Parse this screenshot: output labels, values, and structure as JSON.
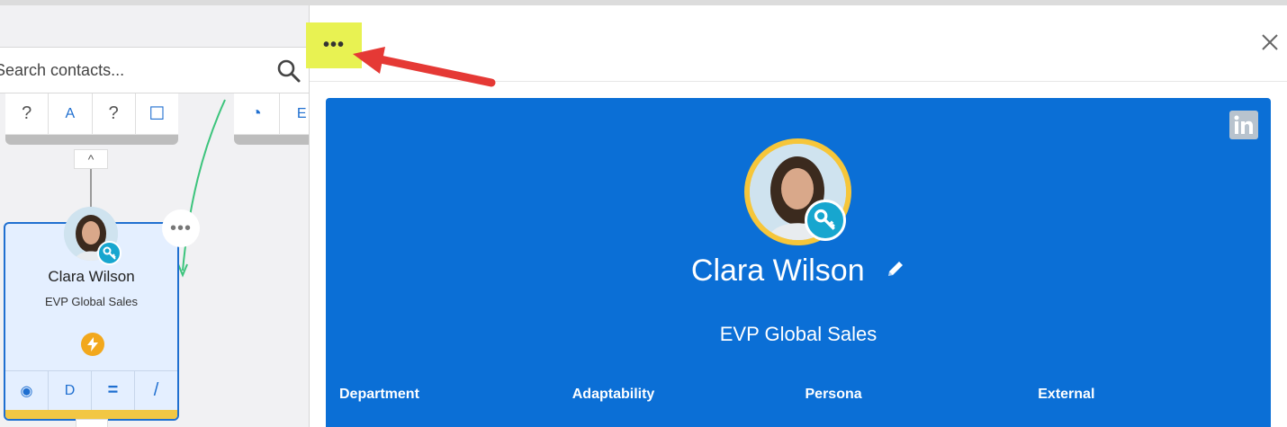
{
  "search": {
    "placeholder": "Search contacts..."
  },
  "top_card_left": {
    "cells": [
      "?",
      "A",
      "?",
      "☐"
    ]
  },
  "top_card_right": {
    "cells": [
      "◔",
      "E"
    ]
  },
  "collapse_label": "^",
  "contact_card": {
    "name": "Clara Wilson",
    "title": "EVP Global Sales",
    "actions": [
      "◉",
      "D",
      "=",
      "/"
    ]
  },
  "panel": {
    "more_label": "•••",
    "profile": {
      "name": "Clara Wilson",
      "title": "EVP Global Sales",
      "fields": [
        "Department",
        "Adaptability",
        "Persona",
        "External"
      ]
    }
  },
  "colors": {
    "accent_blue": "#0b6fd6",
    "highlight_yellow": "#e8f252",
    "key_badge": "#17a6cf",
    "ring_gold": "#f6c63a",
    "arrow_red": "#e53935",
    "connector_green": "#3cc47c"
  }
}
